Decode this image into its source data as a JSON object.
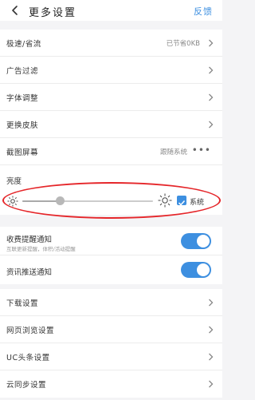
{
  "header": {
    "title": "更多设置",
    "feedback_label": "反馈"
  },
  "settings_group_1": [
    {
      "label": "极速/省流",
      "value": "已节省0KB",
      "trailing": "chevron"
    },
    {
      "label": "广告过滤",
      "value": "",
      "trailing": "chevron"
    },
    {
      "label": "字体调整",
      "value": "",
      "trailing": "chevron"
    },
    {
      "label": "更换皮肤",
      "value": "",
      "trailing": "chevron"
    },
    {
      "label": "截图屏幕",
      "value": "跟随系统",
      "trailing": "more"
    }
  ],
  "brightness": {
    "label": "亮度",
    "level": 0.29,
    "follow_system_label": "系统",
    "follow_system_checked": true
  },
  "notifications": [
    {
      "label": "收费提醒通知",
      "sub": "互联更新提醒，体积/活动提醒",
      "enabled": true
    },
    {
      "label": "资讯推送通知",
      "sub": "",
      "enabled": true
    }
  ],
  "settings_group_2": [
    {
      "label": "下载设置"
    },
    {
      "label": "网页浏览设置"
    },
    {
      "label": "UC头条设置"
    },
    {
      "label": "云同步设置"
    }
  ],
  "colors": {
    "accent": "#3d8fe0",
    "highlight_ellipse": "#e5262a"
  }
}
